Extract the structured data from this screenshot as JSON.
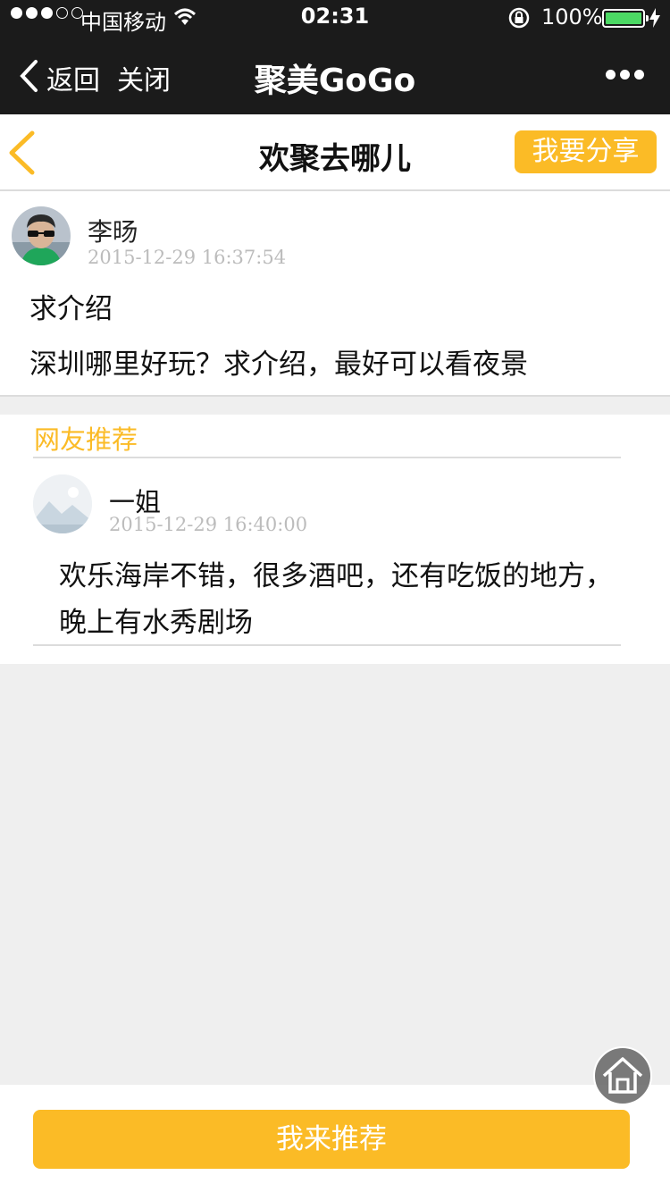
{
  "status_bar": {
    "carrier": "中国移动",
    "time": "02:31",
    "battery_percent": "100%",
    "battery_level": 1.0,
    "signal_bars": 3,
    "signal_total": 5
  },
  "nav_bar": {
    "back_label": "返回",
    "close_label": "关闭",
    "title": "聚美GoGo"
  },
  "page_header": {
    "title": "欢聚去哪儿",
    "share_label": "我要分享"
  },
  "post": {
    "author": "李旸",
    "time": "2015-12-29 16:37:54",
    "title": "求介绍",
    "body": "深圳哪里好玩？求介绍，最好可以看夜景"
  },
  "recommendations": {
    "heading": "网友推荐",
    "items": [
      {
        "author": "一姐",
        "time": "2015-12-29 16:40:00",
        "body": "欢乐海岸不错，很多酒吧，还有吃饭的地方，晚上有水秀剧场"
      }
    ]
  },
  "bottom": {
    "recommend_label": "我来推荐"
  },
  "colors": {
    "accent": "#fbbb26",
    "nav_background": "#1b1b1b",
    "page_background": "#efefef"
  }
}
